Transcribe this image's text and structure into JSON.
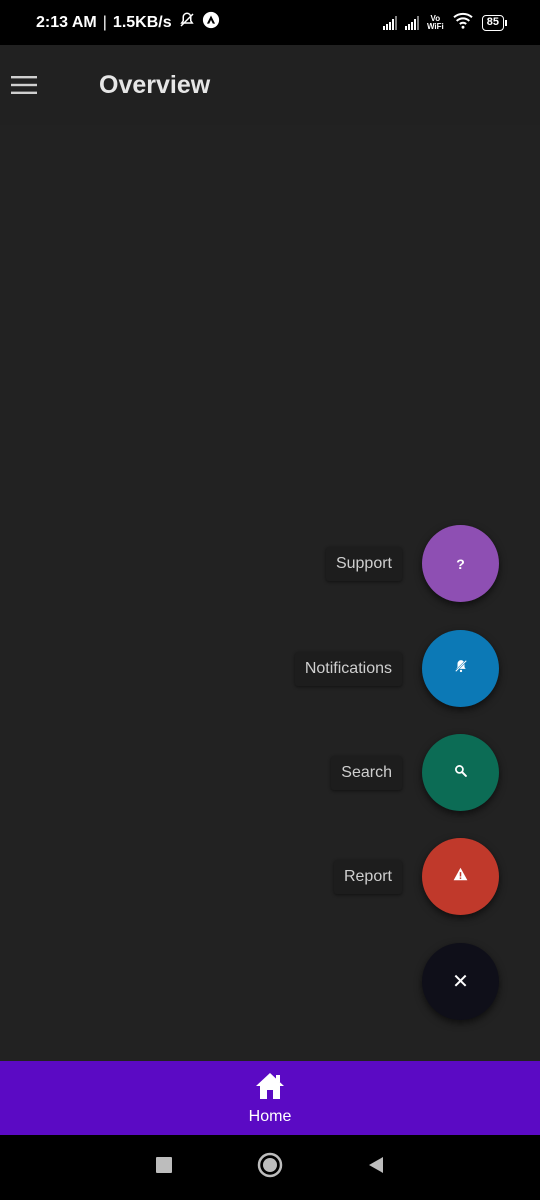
{
  "status_bar": {
    "time": "2:13 AM",
    "speed": "1.5KB/s",
    "vowifi_top": "Vo",
    "vowifi_bottom": "WiFi",
    "battery": "85"
  },
  "app_bar": {
    "title": "Overview",
    "menu_icon": "hamburger-menu-icon"
  },
  "fab_menu": {
    "actions": [
      {
        "label": "Support",
        "icon": "help-icon",
        "glyph": "?",
        "color": "#8e4fb3"
      },
      {
        "label": "Notifications",
        "icon": "bell-off-icon",
        "color": "#0c79b6"
      },
      {
        "label": "Search",
        "icon": "search-icon",
        "color": "#0c6c55"
      },
      {
        "label": "Report",
        "icon": "warning-icon",
        "color": "#c0392b"
      }
    ],
    "close": {
      "icon": "close-icon",
      "glyph": "✕",
      "color": "#0f0f19"
    }
  },
  "bottom_nav": {
    "items": [
      {
        "label": "Home",
        "icon": "home-icon"
      }
    ],
    "color": "#5b0ac4"
  }
}
